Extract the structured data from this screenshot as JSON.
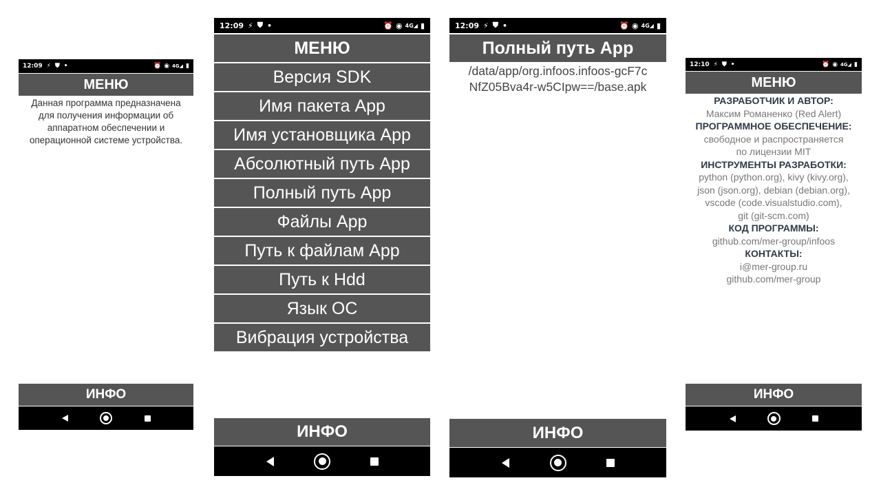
{
  "status": {
    "time_a": "12:09",
    "time_b": "12:10",
    "left_icons": [
      "flash-icon",
      "shield-icon",
      "dot-icon"
    ],
    "right_icons": [
      "alarm-icon",
      "hotspot-icon",
      "signal-4g-icon",
      "battery-icon"
    ],
    "network": "4G"
  },
  "screen1": {
    "title": "МЕНЮ",
    "description": "Данная программа предназначена для получения информации об аппаратном обеспечении и операционной системе устройства.",
    "info_label": "ИНФО"
  },
  "screen2": {
    "title": "МЕНЮ",
    "menu_items": [
      "Версия SDK",
      "Имя пакета App",
      "Имя установщика App",
      "Абсолютный путь App",
      "Полный путь App",
      "Файлы App",
      "Путь к файлам App",
      "Путь к Hdd",
      "Язык ОС",
      "Вибрация устройства"
    ],
    "info_label": "ИНФО"
  },
  "screen3": {
    "title": "Полный путь App",
    "path_line1": "/data/app/org.infoos.infoos-gcF7c",
    "path_line2": "NfZ05Bva4r-w5CIpw==/base.apk",
    "info_label": "ИНФО"
  },
  "screen4": {
    "title": "МЕНЮ",
    "about": [
      {
        "heading": "РАЗРАБОТЧИК И АВТОР:",
        "lines": [
          "Максим Романенко (Red Alert)"
        ]
      },
      {
        "heading": "ПРОГРАММНОЕ ОБЕСПЕЧЕНИЕ:",
        "lines": [
          "свободное и распространяется",
          "по лицензии MIT"
        ]
      },
      {
        "heading": "ИНСТРУМЕНТЫ РАЗРАБОТКИ:",
        "lines": [
          "python (python.org), kivy (kivy.org),",
          "json (json.org), debian (debian.org),",
          "vscode (code.visualstudio.com),",
          "git (git-scm.com)"
        ]
      },
      {
        "heading": "КОД ПРОГРАММЫ:",
        "lines": [
          "github.com/mer-group/infoos"
        ]
      },
      {
        "heading": "КОНТАКТЫ:",
        "lines": [
          "i@mer-group.ru",
          "github.com/mer-group"
        ]
      }
    ],
    "info_label": "ИНФО"
  },
  "navbar": {
    "back": "back-icon",
    "home": "home-icon",
    "recent": "recent-apps-icon"
  }
}
